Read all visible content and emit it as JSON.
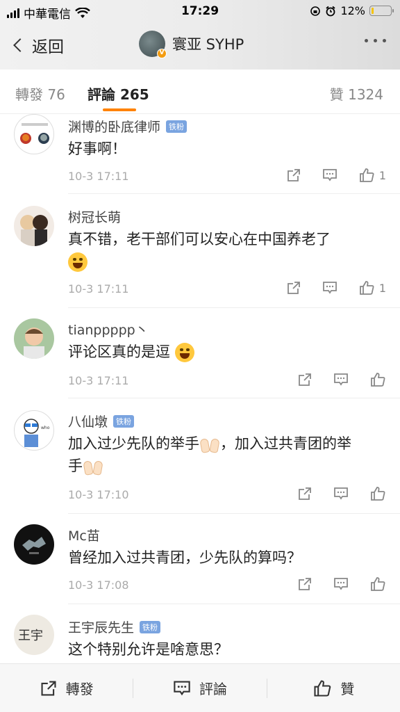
{
  "status": {
    "carrier": "中華電信",
    "time": "17:29",
    "battery_pct": "12%",
    "battery_level": 0.12
  },
  "nav": {
    "back_label": "返回",
    "title": "寰亚 SYHP",
    "verified_badge": "V"
  },
  "tabs": {
    "repost": "轉發 76",
    "comments": "評論 265",
    "likes": "贊 1324"
  },
  "comments": [
    {
      "name": "渊博的卧底律师",
      "badge": "铁粉",
      "text": "好事啊！",
      "time": "10-3 17:11",
      "likes": "1"
    },
    {
      "name": "树冠长萌",
      "badge": "",
      "text": "真不错，老干部们可以安心在中国养老了",
      "time": "10-3 17:11",
      "likes": "1"
    },
    {
      "name": "tianppppp丶",
      "badge": "",
      "text": "评论区真的是逗",
      "time": "10-3 17:11",
      "likes": ""
    },
    {
      "name": "八仙墩",
      "badge": "铁粉",
      "text_a": "加入过少先队的举手",
      "text_b": "，加入过共青团的举",
      "text_c": "手",
      "time": "10-3 17:10",
      "likes": ""
    },
    {
      "name": "Mc苗",
      "badge": "",
      "text": "曾经加入过共青团，少先队的算吗？",
      "time": "10-3 17:08",
      "likes": ""
    },
    {
      "name": "王宇辰先生",
      "badge": "铁粉",
      "text": "这个特别允许是啥意思？",
      "time": "",
      "likes": ""
    }
  ],
  "bottom_bar": {
    "repost": "轉發",
    "comment": "評論",
    "like": "贊"
  },
  "icons": [
    "wifi-icon",
    "lock-rotation-icon",
    "alarm-icon",
    "share-icon",
    "comment-icon",
    "thumbs-up-icon"
  ],
  "colors": {
    "accent": "#ff8200",
    "fan_badge": "#7aa4e0",
    "battery": "#f5c400"
  }
}
